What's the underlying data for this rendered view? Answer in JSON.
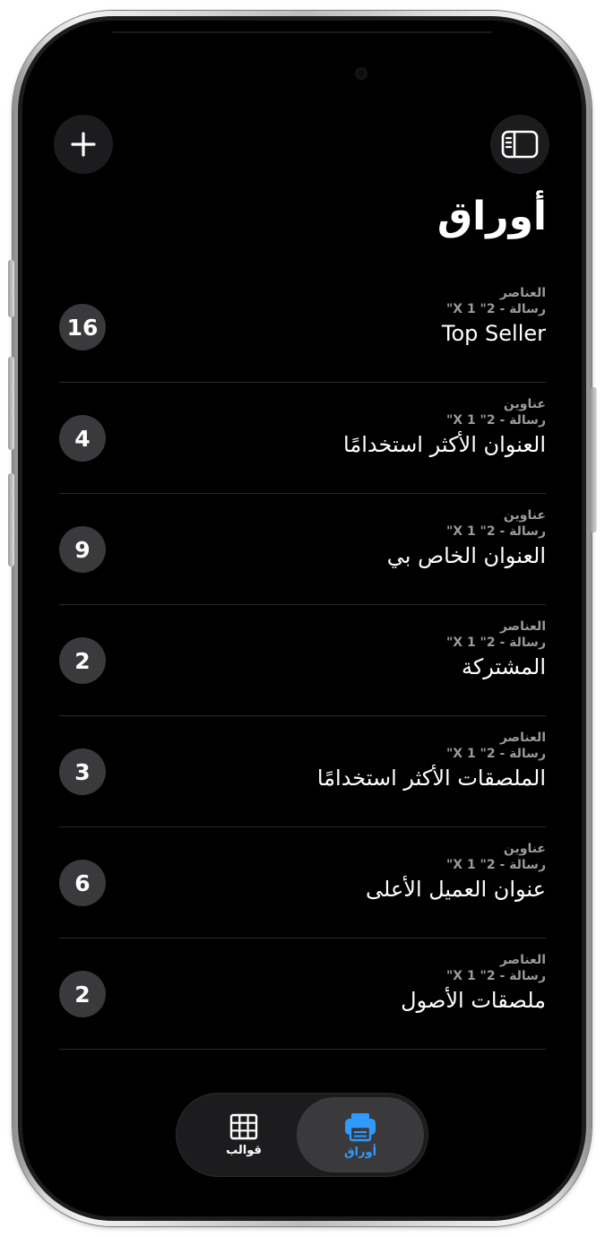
{
  "header": {
    "title": "أوراق",
    "add_icon": "plus-icon",
    "sidebar_icon": "sidebar-icon"
  },
  "sheets": [
    {
      "category": "العناصر",
      "size": "رسالة - 2\" 1 X\"",
      "name": "Top Seller",
      "count": "16"
    },
    {
      "category": "عناوين",
      "size": "رسالة - 2\" 1 X\"",
      "name": "العنوان الأكثر استخدامًا",
      "count": "4"
    },
    {
      "category": "عناوين",
      "size": "رسالة - 2\" 1 X\"",
      "name": "العنوان الخاص بي",
      "count": "9"
    },
    {
      "category": "العناصر",
      "size": "رسالة - 2\" 1 X\"",
      "name": "المشتركة",
      "count": "2"
    },
    {
      "category": "العناصر",
      "size": "رسالة - 2\" 1 X\"",
      "name": "الملصقات الأكثر استخدامًا",
      "count": "3"
    },
    {
      "category": "عناوين",
      "size": "رسالة - 2\" 1 X\"",
      "name": "عنوان العميل الأعلى",
      "count": "6"
    },
    {
      "category": "العناصر",
      "size": "رسالة - 2\" 1 X\"",
      "name": "ملصقات الأصول",
      "count": "2"
    }
  ],
  "tabs": [
    {
      "label": "قوالب",
      "icon": "grid-icon",
      "selected": false
    },
    {
      "label": "أوراق",
      "icon": "printer-icon",
      "selected": true
    }
  ],
  "colors": {
    "background": "#000000",
    "accent": "#2f9bff",
    "badge": "#3a3a3c",
    "secondary_text": "#9a9a9e"
  }
}
